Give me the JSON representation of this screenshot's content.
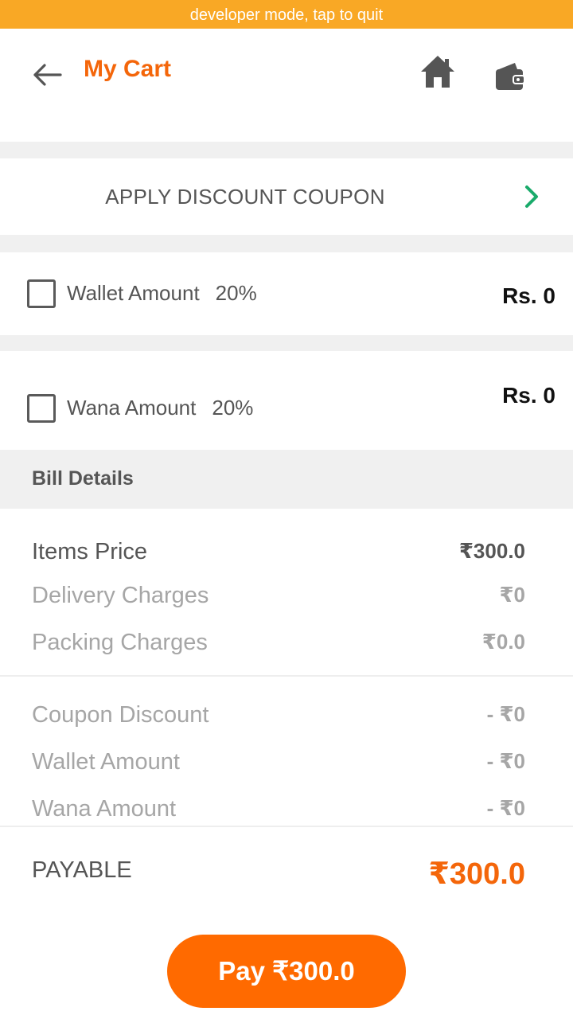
{
  "status_bar": {
    "text": "developer mode, tap to quit"
  },
  "header": {
    "title": "My Cart",
    "back_icon": "arrow-left-icon",
    "home_icon": "home-icon",
    "wallet_icon": "wallet-icon",
    "accent_color": "#f4660a"
  },
  "coupon": {
    "label": "APPLY DISCOUNT COUPON",
    "chevron_icon": "chevron-right-icon",
    "chevron_color": "#1aab6b"
  },
  "wallet_option": {
    "label": "Wallet Amount",
    "percent": "20%",
    "amount": "Rs. 0",
    "checked": false
  },
  "wana_option": {
    "label": "Wana Amount",
    "percent": "20%",
    "amount": "Rs. 0",
    "checked": false
  },
  "bill": {
    "header": "Bill Details",
    "items_price": {
      "label": "Items Price",
      "value": "₹300.0"
    },
    "delivery": {
      "label": "Delivery Charges",
      "value": "₹0"
    },
    "packing": {
      "label": "Packing Charges",
      "value": "₹0.0"
    },
    "coupon_discount": {
      "label": "Coupon Discount",
      "value": "- ₹0"
    },
    "wallet_amount": {
      "label": "Wallet Amount",
      "value": "- ₹0"
    },
    "wana_amount": {
      "label": "Wana Amount",
      "value": "- ₹0"
    },
    "payable": {
      "label": "PAYABLE",
      "value": "₹300.0"
    }
  },
  "pay_button": {
    "label": "Pay ₹300.0",
    "color": "#ff6a00"
  }
}
